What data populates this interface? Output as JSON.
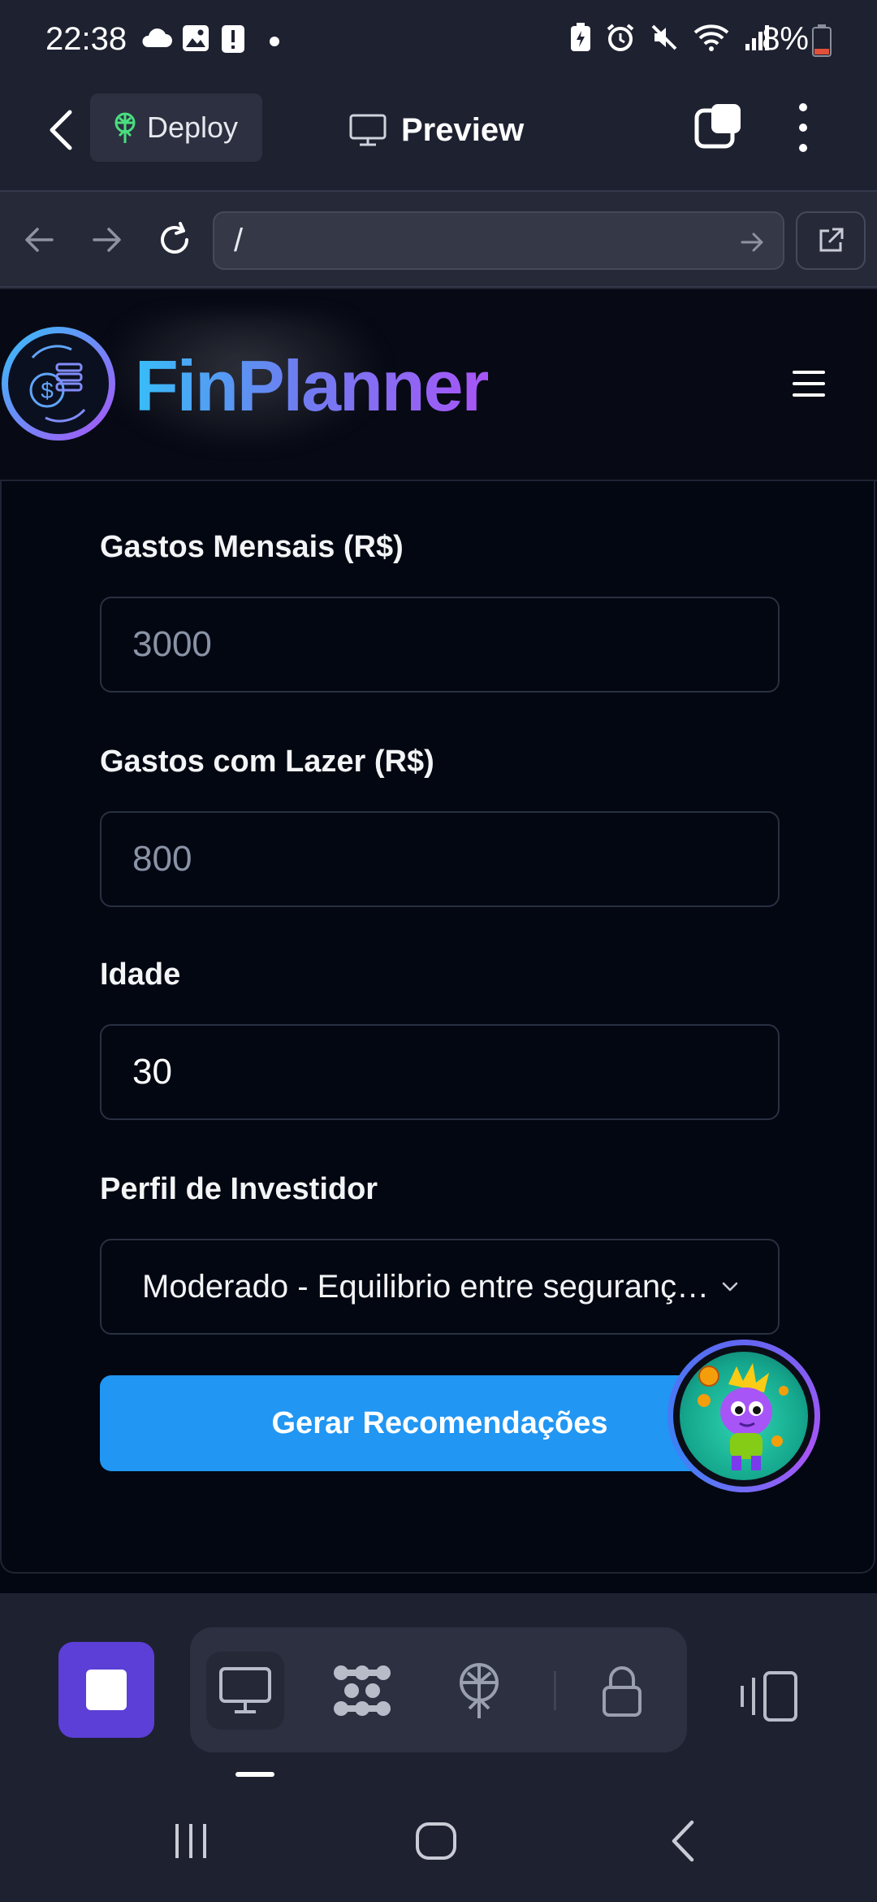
{
  "status_bar": {
    "time": "22:38",
    "battery": "8%",
    "left_icons": [
      "cloud-icon",
      "image-icon",
      "alert-icon",
      "dot-icon"
    ],
    "right_icons": [
      "battery-saver-icon",
      "alarm-icon",
      "mute-icon",
      "wifi-icon",
      "signal-icon",
      "battery-icon"
    ]
  },
  "app_bar": {
    "deploy_label": "Deploy",
    "title": "Preview"
  },
  "browser": {
    "url": "/"
  },
  "site": {
    "brand": "FinPlanner"
  },
  "form": {
    "fields": [
      {
        "label": "Gastos Mensais (R$)",
        "placeholder": "3000",
        "value": ""
      },
      {
        "label": "Gastos com Lazer (R$)",
        "placeholder": "800",
        "value": ""
      },
      {
        "label": "Idade",
        "placeholder": "",
        "value": "30"
      }
    ],
    "profile_label": "Perfil de Investidor",
    "profile_selected": "Moderado - Equilibrio entre segurança e rentabilidade",
    "submit_label": "Gerar Recomendações"
  },
  "colors": {
    "accent_button": "#2196f3",
    "stop_button": "#5b3fd6",
    "brand_gradient": [
      "#38bdf8",
      "#a855f7"
    ]
  }
}
